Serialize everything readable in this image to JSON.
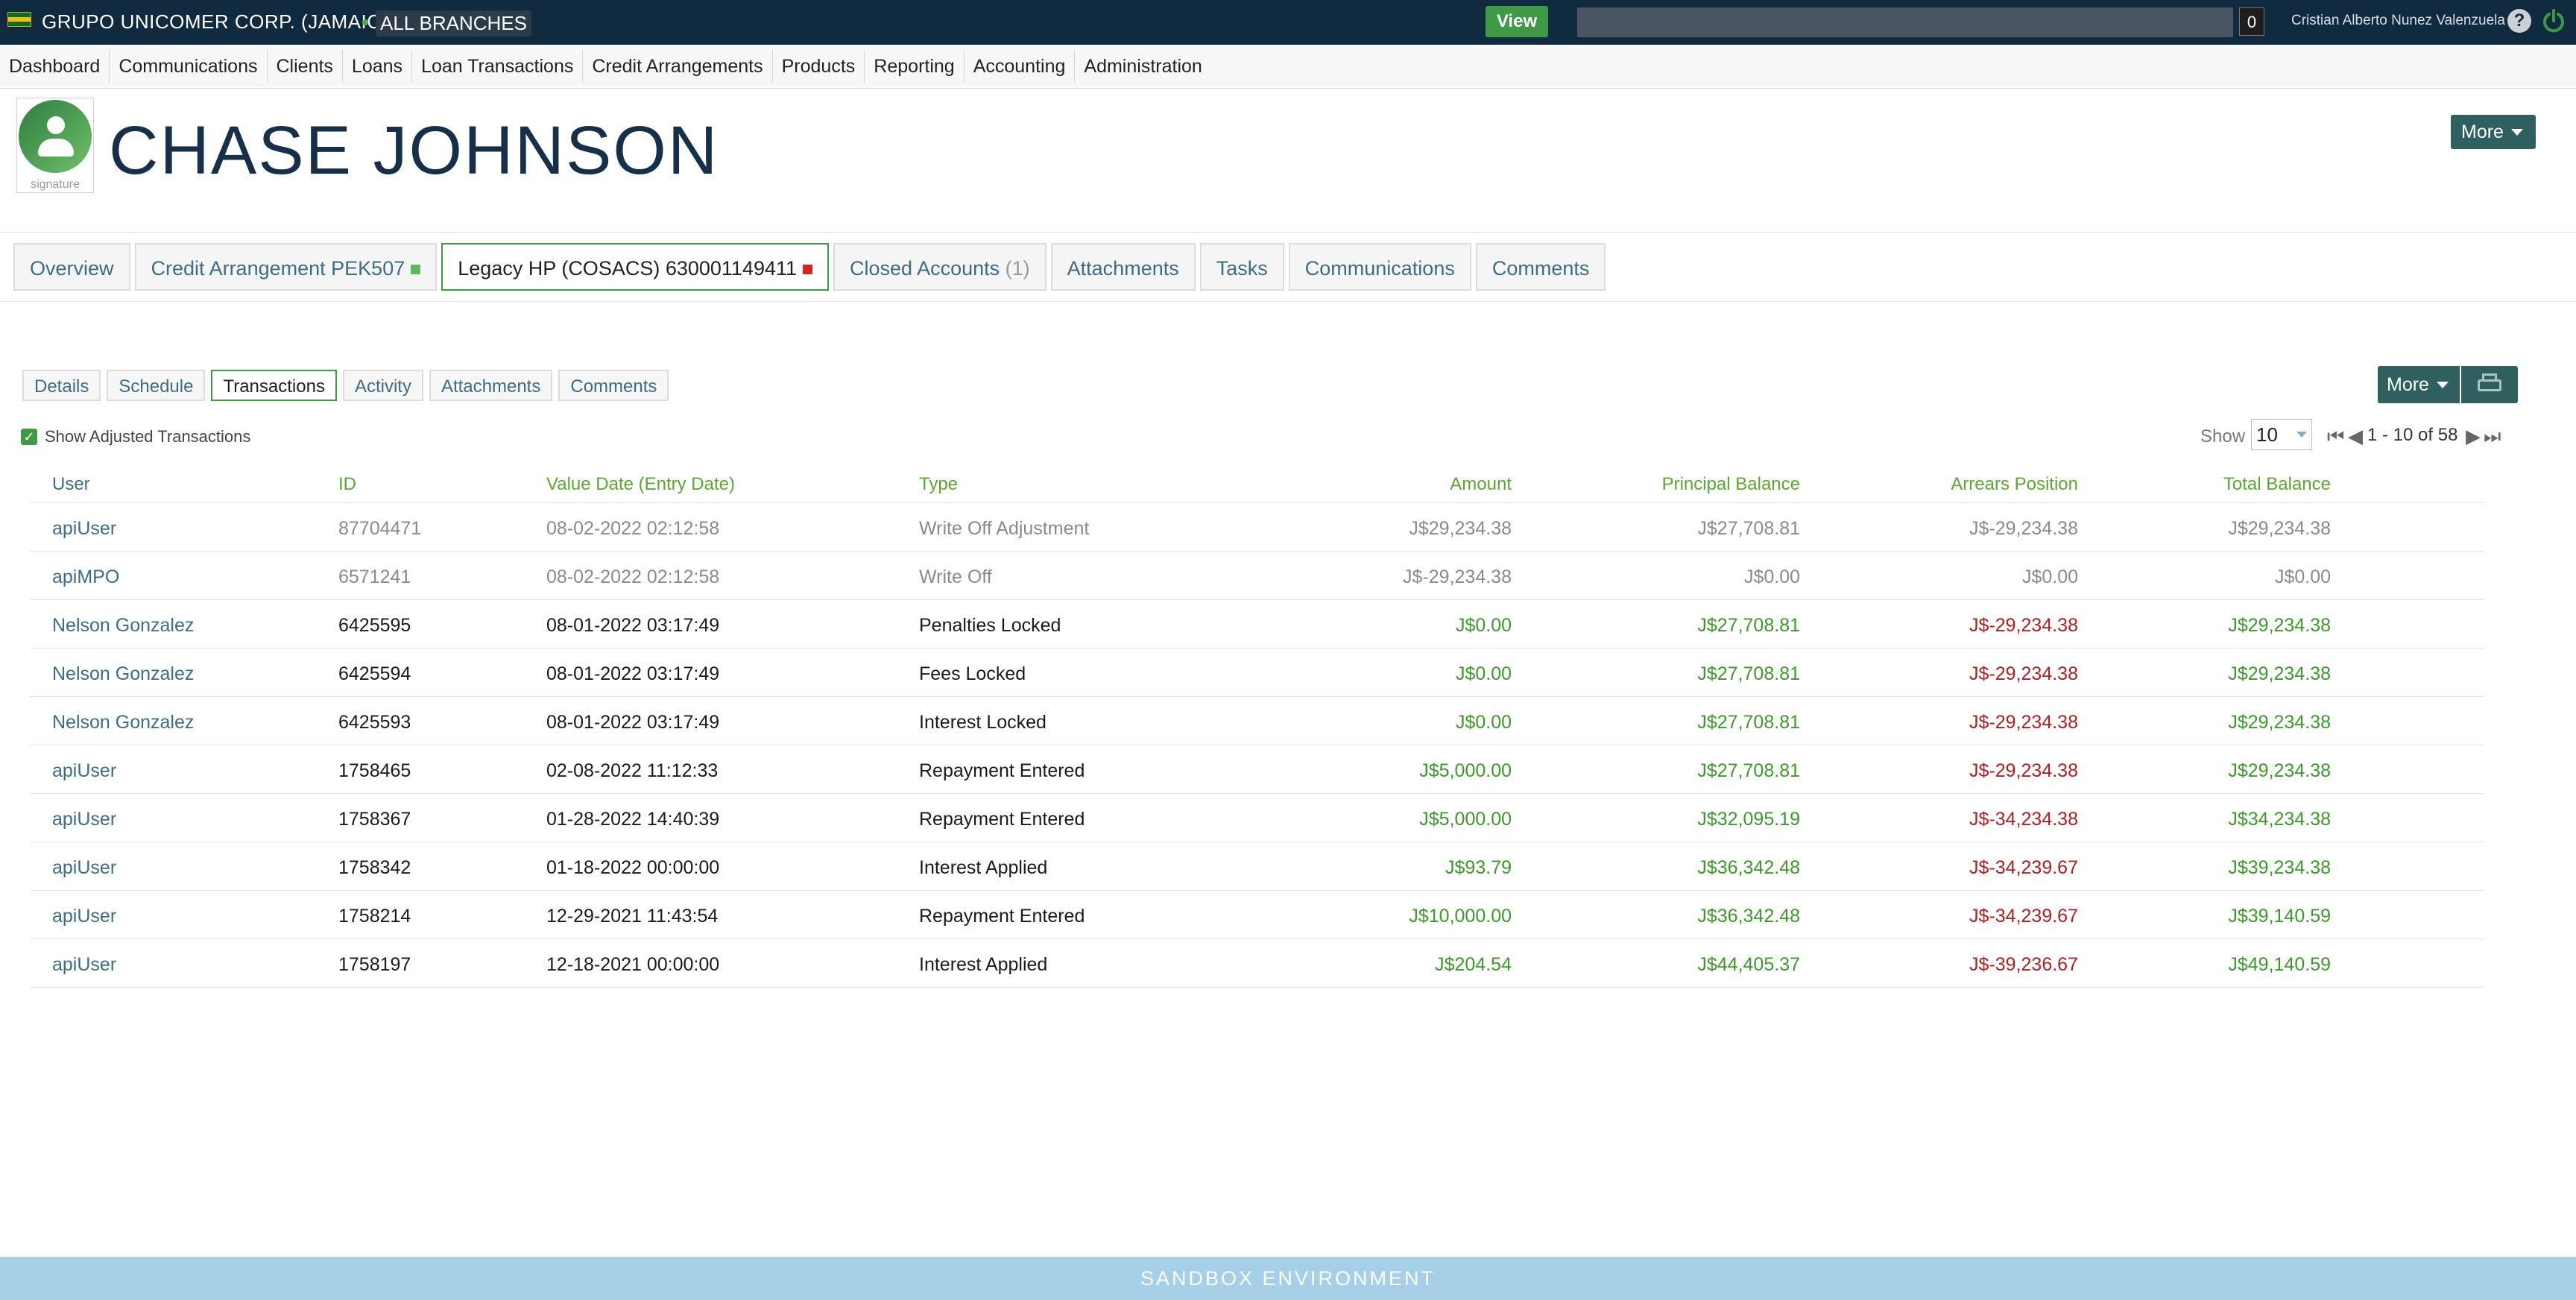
{
  "topbar": {
    "company": "GRUPO UNICOMER CORP. (JAMAICA)",
    "branches": "ALL BRANCHES",
    "view_label": "View",
    "search_value": "",
    "counter": "0",
    "username": "Cristian Alberto Nunez Valenzuela",
    "help_glyph": "?"
  },
  "nav": {
    "items": [
      "Dashboard",
      "Communications",
      "Clients",
      "Loans",
      "Loan Transactions",
      "Credit Arrangements",
      "Products",
      "Reporting",
      "Accounting",
      "Administration"
    ]
  },
  "header": {
    "signature_label": "signature",
    "client_name": "CHASE JOHNSON",
    "more_label": "More"
  },
  "account_tabs": [
    {
      "label": "Overview"
    },
    {
      "label": "Credit Arrangement PEK507",
      "status_color": "#5cb85c"
    },
    {
      "label": "Legacy HP (COSACS) 630001149411",
      "status_color": "#d9231d",
      "active": true
    },
    {
      "label": "Closed Accounts",
      "count": "(1)"
    },
    {
      "label": "Attachments"
    },
    {
      "label": "Tasks"
    },
    {
      "label": "Communications"
    },
    {
      "label": "Comments"
    }
  ],
  "sub_tabs": [
    "Details",
    "Schedule",
    "Transactions",
    "Activity",
    "Attachments",
    "Comments"
  ],
  "sub_tab_active": "Transactions",
  "toolbar": {
    "more_label": "More",
    "show_adjusted_label": "Show Adjusted Transactions",
    "show_label": "Show",
    "page_size": "10",
    "page_info": "1 - 10 of 58"
  },
  "table": {
    "headers": [
      "User",
      "ID",
      "Value Date (Entry Date)",
      "Type",
      "Amount",
      "Principal Balance",
      "Arrears Position",
      "Total Balance"
    ],
    "rows": [
      {
        "user": "apiUser",
        "id": "87704471",
        "date": "08-02-2022 02:12:58",
        "type": "Write Off Adjustment",
        "amount": "J$29,234.38",
        "principal": "J$27,708.81",
        "arrears": "J$-29,234.38",
        "total": "J$29,234.38",
        "adjusted": true
      },
      {
        "user": "apiMPO",
        "id": "6571241",
        "date": "08-02-2022 02:12:58",
        "type": "Write Off",
        "amount": "J$-29,234.38",
        "principal": "J$0.00",
        "arrears": "J$0.00",
        "total": "J$0.00",
        "adjusted": true
      },
      {
        "user": "Nelson Gonzalez",
        "id": "6425595",
        "date": "08-01-2022 03:17:49",
        "type": "Penalties Locked",
        "amount": "J$0.00",
        "principal": "J$27,708.81",
        "arrears": "J$-29,234.38",
        "total": "J$29,234.38"
      },
      {
        "user": "Nelson Gonzalez",
        "id": "6425594",
        "date": "08-01-2022 03:17:49",
        "type": "Fees Locked",
        "amount": "J$0.00",
        "principal": "J$27,708.81",
        "arrears": "J$-29,234.38",
        "total": "J$29,234.38"
      },
      {
        "user": "Nelson Gonzalez",
        "id": "6425593",
        "date": "08-01-2022 03:17:49",
        "type": "Interest Locked",
        "amount": "J$0.00",
        "principal": "J$27,708.81",
        "arrears": "J$-29,234.38",
        "total": "J$29,234.38"
      },
      {
        "user": "apiUser",
        "id": "1758465",
        "date": "02-08-2022 11:12:33",
        "type": "Repayment Entered",
        "amount": "J$5,000.00",
        "principal": "J$27,708.81",
        "arrears": "J$-29,234.38",
        "total": "J$29,234.38"
      },
      {
        "user": "apiUser",
        "id": "1758367",
        "date": "01-28-2022 14:40:39",
        "type": "Repayment Entered",
        "amount": "J$5,000.00",
        "principal": "J$32,095.19",
        "arrears": "J$-34,234.38",
        "total": "J$34,234.38"
      },
      {
        "user": "apiUser",
        "id": "1758342",
        "date": "01-18-2022 00:00:00",
        "type": "Interest Applied",
        "amount": "J$93.79",
        "principal": "J$36,342.48",
        "arrears": "J$-34,239.67",
        "total": "J$39,234.38"
      },
      {
        "user": "apiUser",
        "id": "1758214",
        "date": "12-29-2021 11:43:54",
        "type": "Repayment Entered",
        "amount": "J$10,000.00",
        "principal": "J$36,342.48",
        "arrears": "J$-34,239.67",
        "total": "J$39,140.59"
      },
      {
        "user": "apiUser",
        "id": "1758197",
        "date": "12-18-2021 00:00:00",
        "type": "Interest Applied",
        "amount": "J$204.54",
        "principal": "J$44,405.37",
        "arrears": "J$-39,236.67",
        "total": "J$49,140.59"
      }
    ]
  },
  "footer": {
    "label": "SANDBOX ENVIRONMENT"
  },
  "colors": {
    "topbar": "#102a40",
    "accent_green": "#3f9a47",
    "action_teal": "#2f5f5f",
    "negative_red": "#b02020",
    "link_blue": "#3b6d86",
    "footer": "#a6cfe8"
  }
}
